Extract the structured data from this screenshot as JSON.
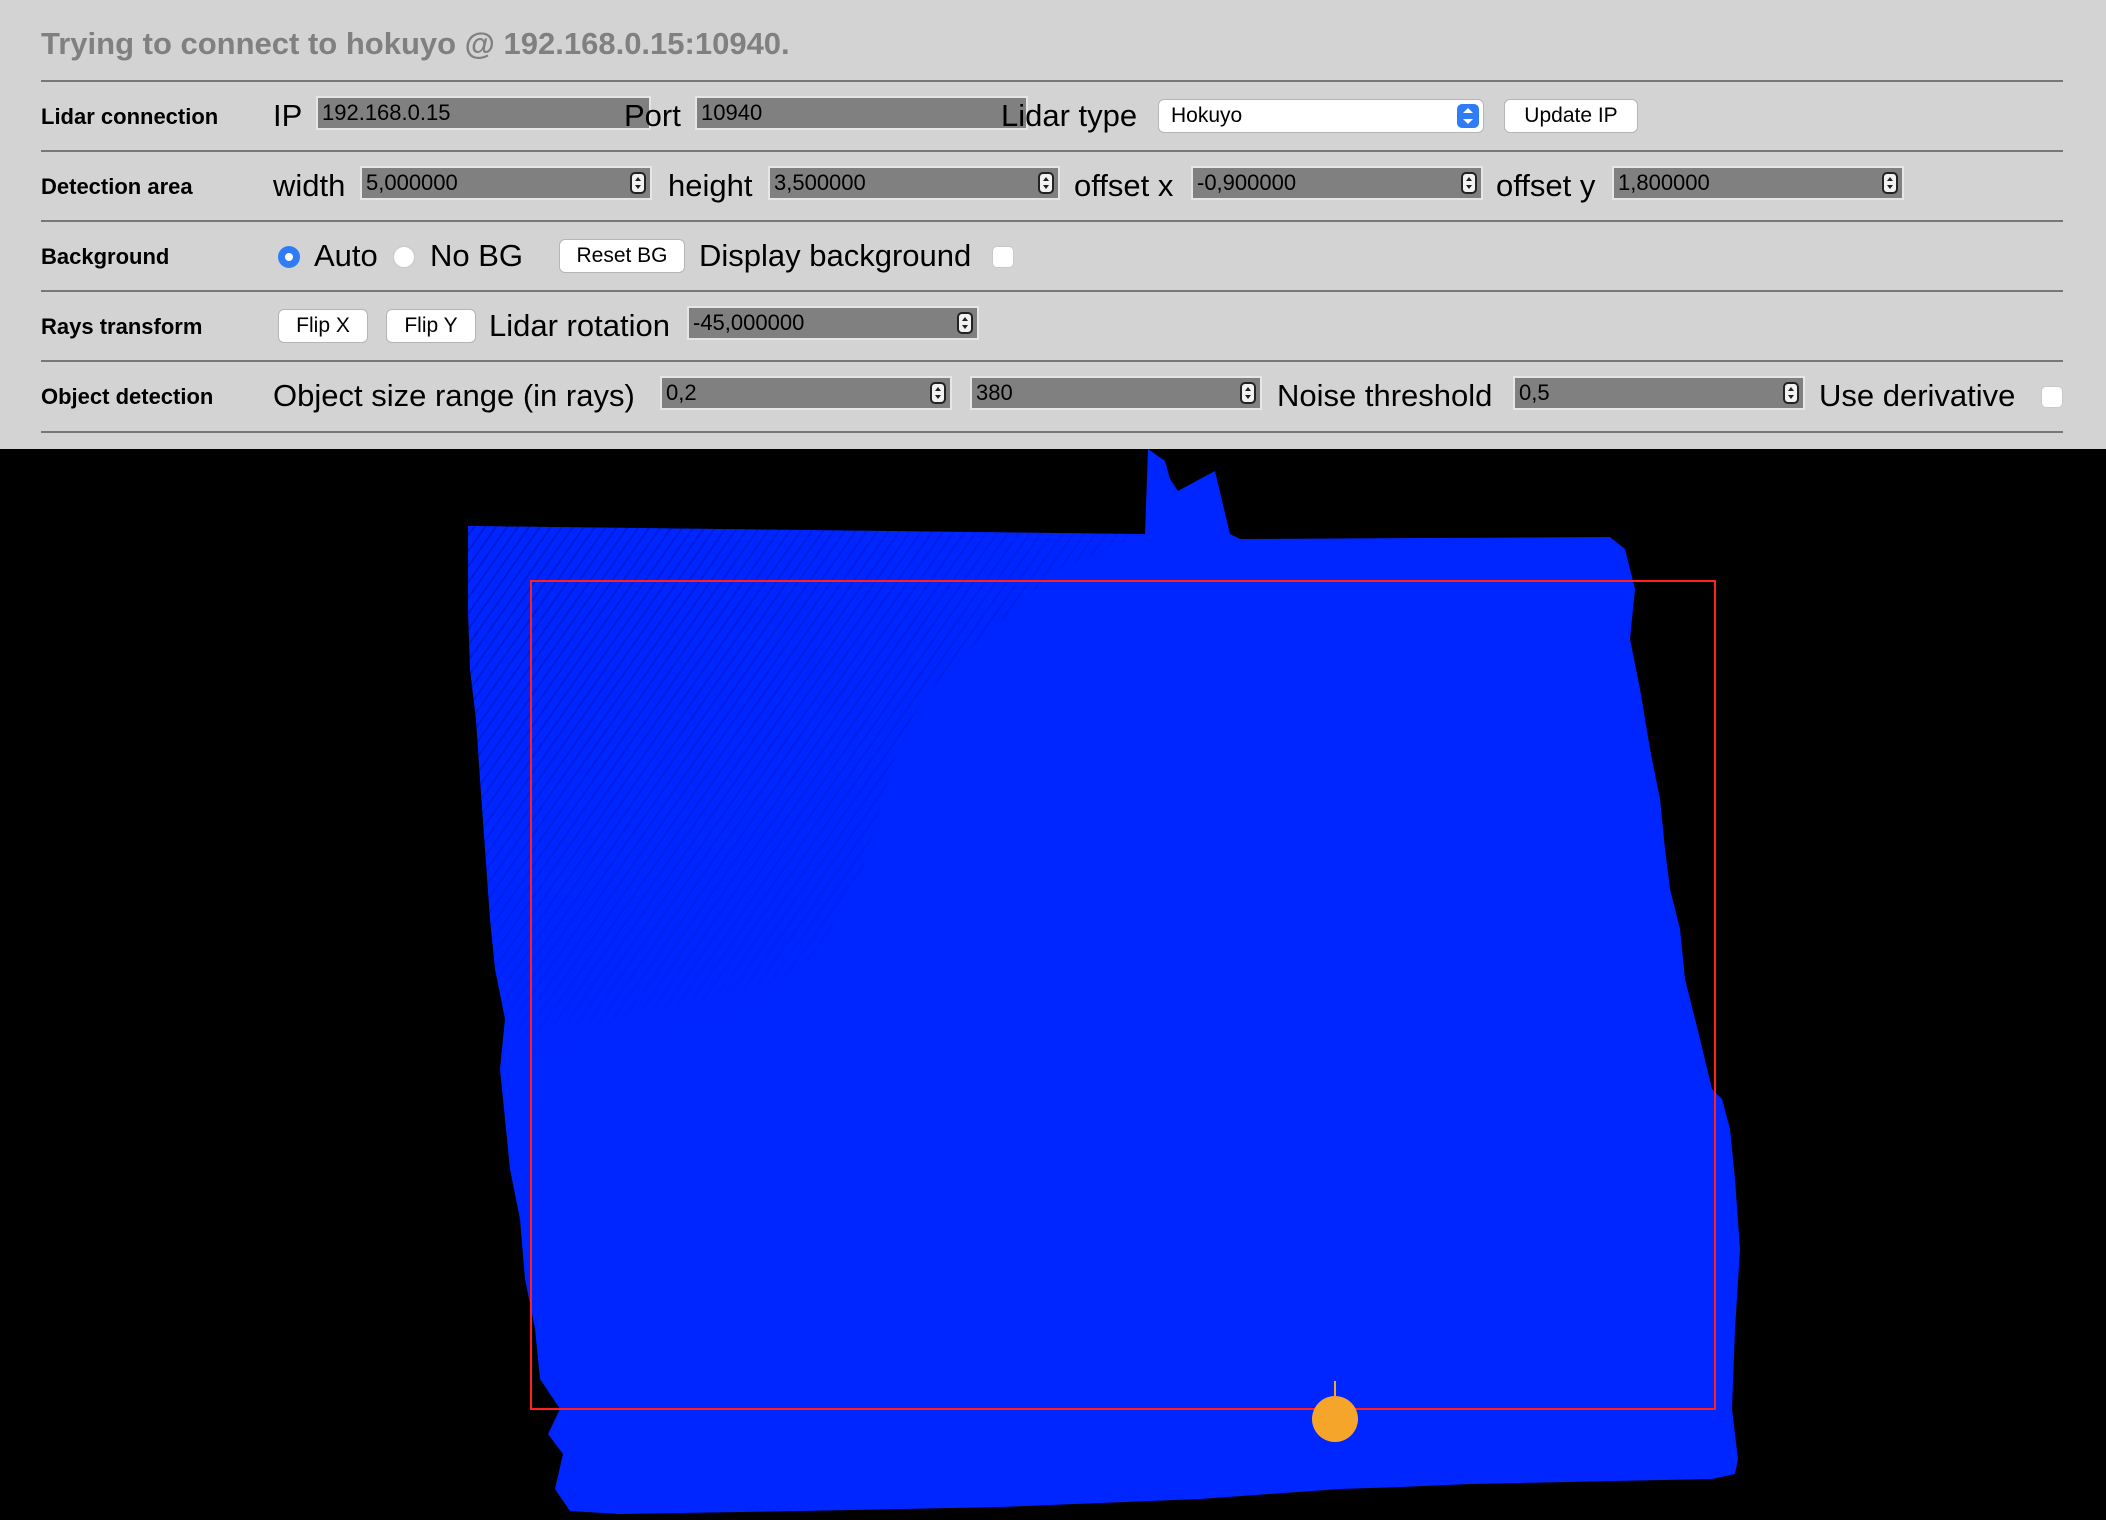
{
  "status": "Trying to connect to hokuyo @ 192.168.0.15:10940.",
  "rows": {
    "lidar": {
      "title": "Lidar connection",
      "ip_label": "IP",
      "ip_value": "192.168.0.15",
      "port_label": "Port",
      "port_value": "10940",
      "type_label": "Lidar type",
      "type_value": "Hokuyo",
      "update_label": "Update IP"
    },
    "detection": {
      "title": "Detection area",
      "width_label": "width",
      "width_value": "5,000000",
      "height_label": "height",
      "height_value": "3,500000",
      "offx_label": "offset x",
      "offx_value": "-0,900000",
      "offy_label": "offset y",
      "offy_value": "1,800000"
    },
    "background": {
      "title": "Background",
      "auto_label": "Auto",
      "nobg_label": "No BG",
      "reset_label": "Reset BG",
      "display_label": "Display background"
    },
    "rays": {
      "title": "Rays transform",
      "flipx_label": "Flip X",
      "flipy_label": "Flip Y",
      "rotation_label": "Lidar rotation",
      "rotation_value": "-45,000000"
    },
    "objects": {
      "title": "Object detection",
      "size_label": "Object size range (in rays)",
      "size_min": "0,2",
      "size_max": "380",
      "noise_label": "Noise threshold",
      "noise_value": "0,5",
      "derivative_label": "Use derivative"
    }
  },
  "visualization": {
    "point_color": "#0026ff",
    "dense_ray_color": "#0018c8",
    "detection_box_color": "#ff2020",
    "lidar_marker_color": "#f5a52a",
    "background_color": "#000000"
  }
}
